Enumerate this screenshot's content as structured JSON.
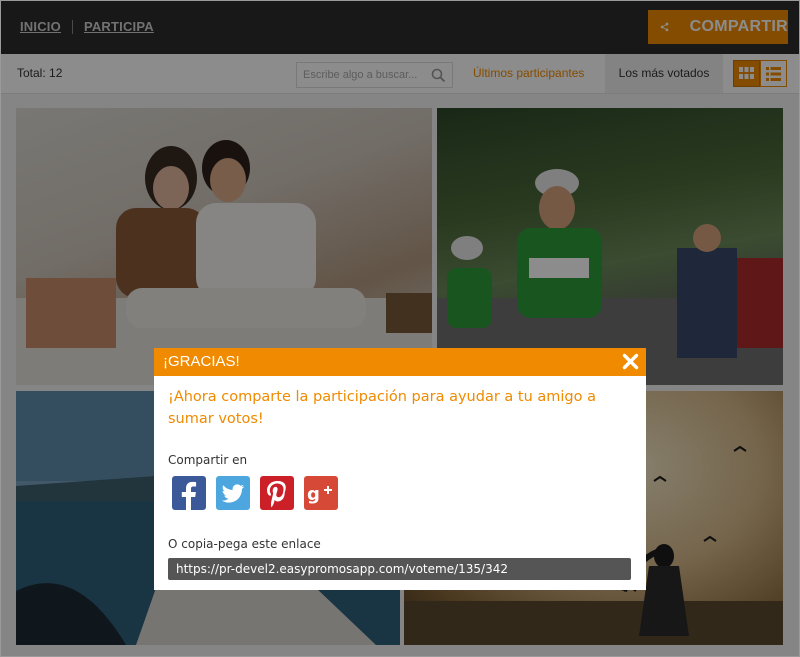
{
  "nav": {
    "home": "INICIO",
    "participate": "PARTICIPA",
    "share_button": "COMPARTIR"
  },
  "filter": {
    "total": "Total: 12",
    "search_placeholder": "Escribe algo a buscar...",
    "tab_latest": "Últimos participantes",
    "tab_most_voted": "Los más votados"
  },
  "grid": {
    "photos": [
      {
        "subject": "couple-photo"
      },
      {
        "subject": "cyclists-photo"
      },
      {
        "subject": "pier-photo"
      },
      {
        "subject": "birds-girl-photo"
      }
    ]
  },
  "modal": {
    "title": "¡GRACIAS!",
    "message": "¡Ahora comparte la participación para ayudar a tu amigo a sumar votos!",
    "share_label": "Compartir en",
    "copy_label": "O copia-pega este enlace",
    "link": "https://pr-devel2.easypromosapp.com/voteme/135/342",
    "socials": [
      "facebook-icon",
      "twitter-icon",
      "pinterest-icon",
      "google-plus-icon"
    ]
  },
  "colors": {
    "accent": "#f08a00",
    "topbar": "#2c2c2c",
    "facebook": "#3b5998",
    "twitter": "#4da7de",
    "pinterest": "#cb2027",
    "google_plus": "#d64937"
  }
}
